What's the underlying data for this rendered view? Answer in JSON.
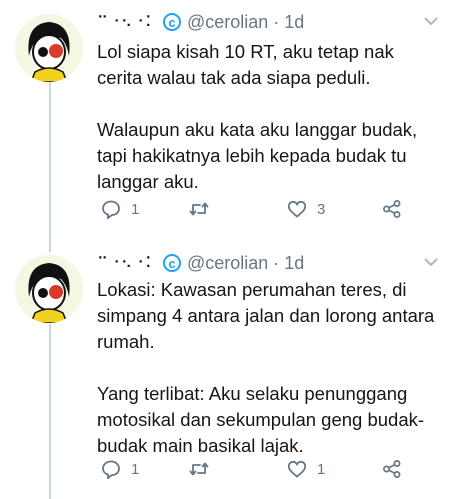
{
  "tweets": [
    {
      "display_name": "⠉⠐⠢⠐⠅",
      "badge": "c",
      "handle": "@cerolian",
      "time": "· 1d",
      "lines": [
        "Lol siapa kisah 10 RT, aku tetap nak",
        "cerita walau tak ada siapa peduli."
      ],
      "lines2": [
        "Walaupun aku kata aku langgar budak,",
        "tapi hakikatnya lebih kepada budak tu",
        "langgar aku."
      ],
      "reply_count": "1",
      "retweet_count": "",
      "like_count": "3"
    },
    {
      "display_name": "⠉⠐⠢⠐⠅",
      "badge": "c",
      "handle": "@cerolian",
      "time": "· 1d",
      "lines": [
        "Lokasi: Kawasan perumahan teres, di",
        "simpang 4 antara jalan dan lorong antara",
        "rumah."
      ],
      "lines2": [
        "Yang terlibat: Aku selaku penunggang",
        "motosikal dan sekumpulan geng budak-",
        "budak main basikal lajak."
      ],
      "reply_count": "1",
      "retweet_count": "",
      "like_count": "1"
    }
  ],
  "icons": [
    "reply-icon",
    "retweet-icon",
    "like-icon",
    "share-icon",
    "chevron-down-icon"
  ],
  "colors": {
    "text": "#14171a",
    "muted": "#657786",
    "accent": "#1da1f2",
    "thread_line": "#ccd6dd"
  }
}
